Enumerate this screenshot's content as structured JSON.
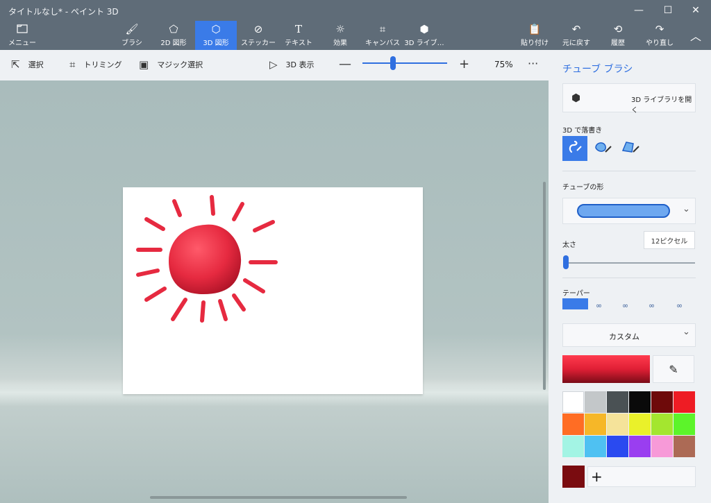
{
  "window": {
    "title": "タイトルなし* - ペイント 3D",
    "minimize": "—",
    "maximize": "☐",
    "close": "✕"
  },
  "ribbon": {
    "menu": {
      "label": "メニュー",
      "icon": "folder-icon"
    },
    "tools": [
      {
        "label": "ブラシ",
        "icon": "brush-icon"
      },
      {
        "label": "2D 図形",
        "icon": "2d-shapes-icon"
      },
      {
        "label": "3D 図形",
        "icon": "3d-shapes-icon"
      },
      {
        "label": "ステッカー",
        "icon": "sticker-icon"
      },
      {
        "label": "テキスト",
        "icon": "text-icon"
      },
      {
        "label": "効果",
        "icon": "effects-icon"
      },
      {
        "label": "キャンバス",
        "icon": "canvas-icon"
      },
      {
        "label": "3D ライブ…",
        "icon": "3d-library-icon"
      }
    ],
    "right": [
      {
        "label": "貼り付け",
        "icon": "paste-icon"
      },
      {
        "label": "元に戻す",
        "icon": "undo-icon"
      },
      {
        "label": "履歴",
        "icon": "history-icon"
      },
      {
        "label": "やり直し",
        "icon": "redo-icon"
      }
    ],
    "collapse": "︿"
  },
  "toolbar": {
    "select": "選択",
    "crop": "トリミング",
    "magic_select": "マジック選択",
    "view_3d": "3D 表示",
    "zoom_minus": "—",
    "zoom_plus": "+",
    "zoom_value": "75%",
    "zoom_level": 0.75,
    "more": "···"
  },
  "panel": {
    "title": "チューブ ブラシ",
    "open_library": "3D ライブラリを開く",
    "doodle_label": "3D で落書き",
    "tube_shape_label": "チューブの形",
    "thickness_label": "太さ",
    "thickness_value": "12ピクセル",
    "taper_label": "テーパー",
    "color_mode": "カスタム",
    "add_color": "+",
    "selected_color": "#e01f35",
    "palette": [
      "#ffffff",
      "#c3c7c9",
      "#4a5154",
      "#0a0a0a",
      "#6e0a0a",
      "#ee1c24",
      "#ff6d24",
      "#f6b728",
      "#f5e39a",
      "#eaf12a",
      "#a4e62f",
      "#5cf42a",
      "#a3f4e4",
      "#4fc1f2",
      "#2a4af0",
      "#9a3ef0",
      "#f79ad8",
      "#ac6a55"
    ]
  }
}
